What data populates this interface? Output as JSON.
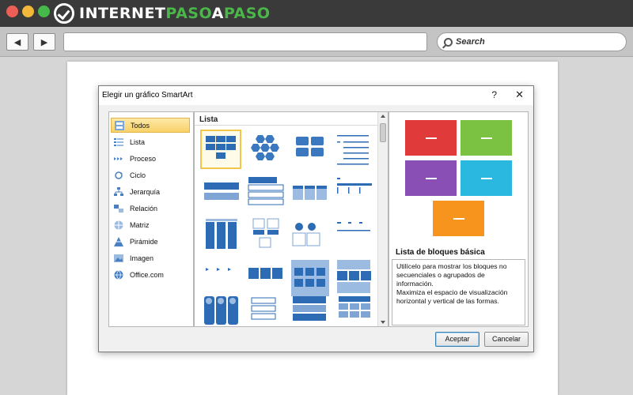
{
  "browser": {
    "logo": {
      "part1": "INTERNET",
      "part2": "PASO",
      "part3": "A",
      "part4": "PASO"
    },
    "nav": {
      "back_glyph": "◀",
      "forward_glyph": "▶"
    },
    "search_placeholder": "Search"
  },
  "dialog": {
    "title": "Elegir un gráfico SmartArt",
    "help": "?",
    "close": "✕",
    "categories": [
      {
        "label": "Todos",
        "icon": "all-icon"
      },
      {
        "label": "Lista",
        "icon": "list-icon"
      },
      {
        "label": "Proceso",
        "icon": "process-icon"
      },
      {
        "label": "Ciclo",
        "icon": "cycle-icon"
      },
      {
        "label": "Jerarquía",
        "icon": "hierarchy-icon"
      },
      {
        "label": "Relación",
        "icon": "relation-icon"
      },
      {
        "label": "Matriz",
        "icon": "matrix-icon"
      },
      {
        "label": "Pirámide",
        "icon": "pyramid-icon"
      },
      {
        "label": "Imagen",
        "icon": "image-icon"
      },
      {
        "label": "Office.com",
        "icon": "office-icon"
      }
    ],
    "selected_category": "Todos",
    "gallery_header": "Lista",
    "preview": {
      "title": "Lista de bloques básica",
      "description": [
        "Utilícelo para mostrar los bloques no",
        "secuenciales o agrupados de información.",
        "Maximiza el espacio de visualización",
        "horizontal y vertical de las formas."
      ],
      "colors": {
        "red": "#e03a3a",
        "green": "#7cc242",
        "purple": "#8a4fb5",
        "cyan": "#2ab7e0",
        "orange": "#f7941d"
      }
    },
    "buttons": {
      "ok": "Aceptar",
      "cancel": "Cancelar"
    }
  }
}
